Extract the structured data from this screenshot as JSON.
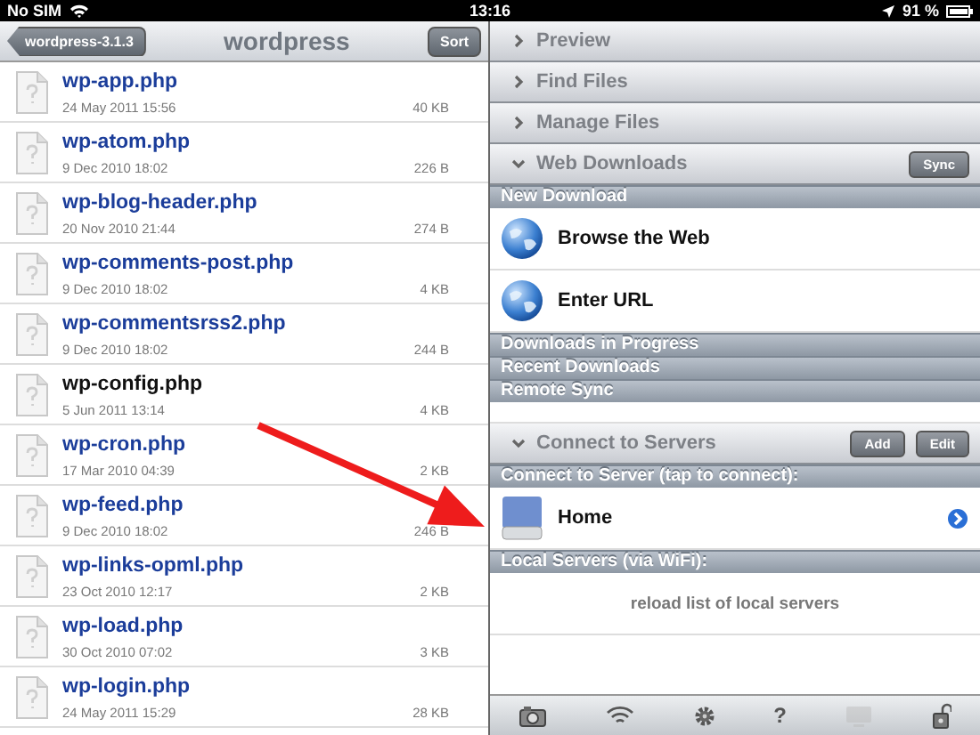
{
  "status_bar": {
    "carrier": "No SIM",
    "time": "13:16",
    "battery": "91 %"
  },
  "left": {
    "back_button": "wordpress-3.1.3",
    "title": "wordpress",
    "sort_button": "Sort",
    "files": [
      {
        "name": "wp-app.php",
        "date": "24 May 2011 15:56",
        "size": "40 KB",
        "kind": "link"
      },
      {
        "name": "wp-atom.php",
        "date": "9 Dec 2010 18:02",
        "size": "226 B",
        "kind": "link"
      },
      {
        "name": "wp-blog-header.php",
        "date": "20 Nov 2010 21:44",
        "size": "274 B",
        "kind": "link"
      },
      {
        "name": "wp-comments-post.php",
        "date": "9 Dec 2010 18:02",
        "size": "4 KB",
        "kind": "link"
      },
      {
        "name": "wp-commentsrss2.php",
        "date": "9 Dec 2010 18:02",
        "size": "244 B",
        "kind": "link"
      },
      {
        "name": "wp-config.php",
        "date": "5 Jun 2011 13:14",
        "size": "4 KB",
        "kind": "plain"
      },
      {
        "name": "wp-cron.php",
        "date": "17 Mar 2010 04:39",
        "size": "2 KB",
        "kind": "link"
      },
      {
        "name": "wp-feed.php",
        "date": "9 Dec 2010 18:02",
        "size": "246 B",
        "kind": "link"
      },
      {
        "name": "wp-links-opml.php",
        "date": "23 Oct 2010 12:17",
        "size": "2 KB",
        "kind": "link"
      },
      {
        "name": "wp-load.php",
        "date": "30 Oct 2010 07:02",
        "size": "3 KB",
        "kind": "link"
      },
      {
        "name": "wp-login.php",
        "date": "24 May 2011 15:29",
        "size": "28 KB",
        "kind": "link"
      }
    ]
  },
  "right": {
    "panels": [
      {
        "title": "Preview",
        "expanded": false
      },
      {
        "title": "Find Files",
        "expanded": false
      },
      {
        "title": "Manage Files",
        "expanded": false
      },
      {
        "title": "Web Downloads",
        "expanded": true,
        "buttons": [
          "Sync"
        ],
        "sections": [
          {
            "title": "New Download",
            "rows": [
              {
                "kind": "globe",
                "label": "Browse the Web"
              },
              {
                "kind": "globe",
                "label": "Enter URL"
              }
            ]
          },
          {
            "title": "Downloads in Progress"
          },
          {
            "title": "Recent Downloads"
          },
          {
            "title": "Remote Sync",
            "rows": [
              {
                "kind": "empty"
              }
            ]
          }
        ]
      },
      {
        "title": "Connect to Servers",
        "expanded": true,
        "buttons": [
          "Add",
          "Edit"
        ],
        "sections": [
          {
            "title": "Connect to Server (tap to connect):",
            "rows": [
              {
                "kind": "server",
                "label": "Home"
              }
            ]
          },
          {
            "title": "Local Servers (via WiFi):",
            "rows": [
              {
                "kind": "action",
                "label": "reload list of local servers"
              }
            ]
          }
        ]
      }
    ],
    "toolbar": [
      {
        "kind": "camera",
        "disabled": false
      },
      {
        "kind": "wifi",
        "disabled": false
      },
      {
        "kind": "gear",
        "disabled": false
      },
      {
        "kind": "text",
        "label": "?",
        "disabled": false
      },
      {
        "kind": "monitor",
        "disabled": true
      },
      {
        "kind": "lock",
        "disabled": false
      }
    ]
  }
}
